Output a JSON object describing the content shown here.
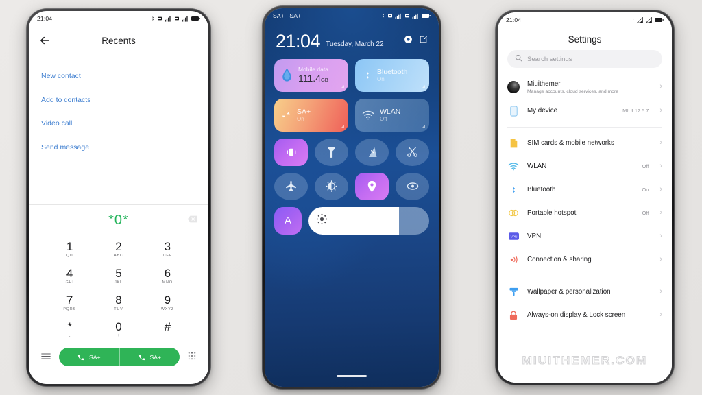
{
  "background_color": "#e9e7e5",
  "phone1": {
    "statusbar": {
      "time": "21:04",
      "icons": [
        "bluetooth-icon",
        "sim1-icon",
        "signal-4g-icon",
        "sim2-icon",
        "signal-4g-icon",
        "battery-icon"
      ]
    },
    "header": {
      "title": "Recents",
      "back_icon": "back-arrow-icon"
    },
    "actions": [
      {
        "label": "New contact"
      },
      {
        "label": "Add to contacts"
      },
      {
        "label": "Video call"
      },
      {
        "label": "Send message"
      }
    ],
    "dialer": {
      "number": "*0*",
      "backspace_icon": "backspace-icon",
      "keys": [
        {
          "num": "1",
          "sub": "QD"
        },
        {
          "num": "2",
          "sub": "ABC"
        },
        {
          "num": "3",
          "sub": "DEF"
        },
        {
          "num": "4",
          "sub": "GHI"
        },
        {
          "num": "5",
          "sub": "JKL"
        },
        {
          "num": "6",
          "sub": "MNO"
        },
        {
          "num": "7",
          "sub": "PQRS"
        },
        {
          "num": "8",
          "sub": "TUV"
        },
        {
          "num": "9",
          "sub": "WXYZ"
        },
        {
          "num": "*",
          "sub": ","
        },
        {
          "num": "0",
          "sub": "+"
        },
        {
          "num": "#",
          "sub": ""
        }
      ],
      "menu_icon": "hamburger-icon",
      "keypad_icon": "keypad-icon",
      "call_buttons": [
        {
          "label": "SA+",
          "icon": "phone-icon"
        },
        {
          "label": "SA+",
          "icon": "phone-icon"
        }
      ],
      "call_color": "#2fb457",
      "number_color": "#23b35a"
    }
  },
  "phone2": {
    "statusbar": {
      "left": "SA+ | SA+",
      "icons": [
        "bluetooth-icon",
        "sim1-icon",
        "signal-4g-icon",
        "sim2-icon",
        "signal-4g-icon",
        "battery-icon"
      ]
    },
    "clock": {
      "time": "21:04",
      "date": "Tuesday, March 22"
    },
    "header_icons": [
      "settings-gear-icon",
      "edit-icon"
    ],
    "big_tiles": [
      {
        "name": "mobile-data",
        "label": "Mobile data",
        "value": "111.4",
        "unit": "GB",
        "icon": "water-drop-icon",
        "active": true
      },
      {
        "name": "bluetooth",
        "label": "Bluetooth",
        "state": "On",
        "icon": "bluetooth-icon",
        "active": true
      },
      {
        "name": "sa-plus",
        "label": "SA+",
        "state": "On",
        "icon": "data-transfer-icon",
        "active": true
      },
      {
        "name": "wlan",
        "label": "WLAN",
        "state": "Off",
        "icon": "wifi-icon",
        "active": false
      }
    ],
    "small_tiles": [
      {
        "name": "vibrate",
        "icon": "vibrate-icon",
        "active": true
      },
      {
        "name": "flashlight",
        "icon": "flashlight-icon",
        "active": false
      },
      {
        "name": "screenshot",
        "icon": "screenshot-icon",
        "active": false
      },
      {
        "name": "screen-record",
        "icon": "scissors-icon",
        "active": false
      },
      {
        "name": "airplane-mode",
        "icon": "airplane-icon",
        "active": false
      },
      {
        "name": "dark-mode",
        "icon": "contrast-icon",
        "active": false
      },
      {
        "name": "location",
        "icon": "location-pin-icon",
        "active": true
      },
      {
        "name": "reading-mode",
        "icon": "eye-icon",
        "active": false
      }
    ],
    "auto_brightness": {
      "label": "A",
      "icon": "auto-brightness-icon"
    },
    "brightness": {
      "icon": "brightness-sun-icon",
      "percent": 75
    },
    "home_indicator": "home-indicator"
  },
  "phone3": {
    "statusbar": {
      "time": "21:04",
      "icons": [
        "bluetooth-icon",
        "signal-icon",
        "signal-icon",
        "battery-icon"
      ]
    },
    "title": "Settings",
    "search": {
      "placeholder": "Search settings",
      "icon": "search-icon"
    },
    "account": {
      "name": "Miuithemer",
      "desc": "Manage accounts, cloud services, and more",
      "avatar": "avatar"
    },
    "groups": [
      {
        "items": [
          {
            "name": "My device",
            "value": "MIUI 12.5.7",
            "icon": "phone-device-icon",
            "color": "#8ec8f0"
          }
        ]
      },
      {
        "items": [
          {
            "name": "SIM cards & mobile networks",
            "value": "",
            "icon": "sim-card-icon",
            "color": "#f5c343"
          },
          {
            "name": "WLAN",
            "value": "Off",
            "icon": "wifi-icon",
            "color": "#4fb8e8"
          },
          {
            "name": "Bluetooth",
            "value": "On",
            "icon": "bluetooth-icon",
            "color": "#3e9ef0"
          },
          {
            "name": "Portable hotspot",
            "value": "Off",
            "icon": "hotspot-icon",
            "color": "#f2c94c"
          },
          {
            "name": "VPN",
            "value": "",
            "icon": "vpn-icon",
            "color": "#5b5be8"
          },
          {
            "name": "Connection & sharing",
            "value": "",
            "icon": "connection-sharing-icon",
            "color": "#ef6a5a"
          }
        ]
      },
      {
        "items": [
          {
            "name": "Wallpaper & personalization",
            "value": "",
            "icon": "wallpaper-brush-icon",
            "color": "#3e9ef0"
          },
          {
            "name": "Always-on display & Lock screen",
            "value": "",
            "icon": "lock-icon",
            "color": "#ef6a5a"
          }
        ]
      }
    ],
    "watermark": "MIUITHEMER.COM"
  }
}
